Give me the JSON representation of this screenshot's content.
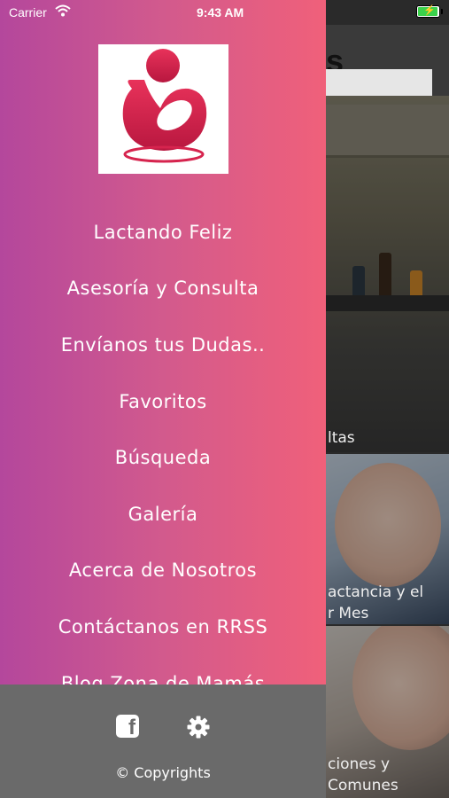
{
  "status_bar": {
    "carrier": "Carrier",
    "time": "9:43 AM",
    "battery_icon": "battery-charging-icon",
    "wifi_icon": "wifi-icon"
  },
  "main": {
    "title_fragment": "s",
    "cards": [
      {
        "caption_lines": [
          "ltas"
        ]
      },
      {
        "caption_lines": [
          "actancia y el",
          "r Mes"
        ]
      },
      {
        "caption_lines": [
          "ciones y",
          "Comunes"
        ]
      }
    ]
  },
  "drawer": {
    "logo_icon": "breastfeeding-logo",
    "menu": [
      {
        "label": "Lactando Feliz"
      },
      {
        "label": "Asesoría y Consulta"
      },
      {
        "label": "Envíanos tus Dudas.."
      },
      {
        "label": "Favoritos"
      },
      {
        "label": "Búsqueda"
      },
      {
        "label": "Galería"
      },
      {
        "label": "Acerca de Nosotros"
      },
      {
        "label": "Contáctanos en RRSS"
      },
      {
        "label": "Blog Zona de Mamás"
      }
    ],
    "footer": {
      "facebook_icon": "facebook-icon",
      "facebook_glyph": "f",
      "settings_icon": "gear-icon",
      "copyright": "© Copyrights"
    }
  },
  "colors": {
    "drawer_gradient_start": "#b4479c",
    "drawer_gradient_end": "#f0607a",
    "footer_bg": "#6a6a6a",
    "logo_accent": "#d6244e"
  }
}
